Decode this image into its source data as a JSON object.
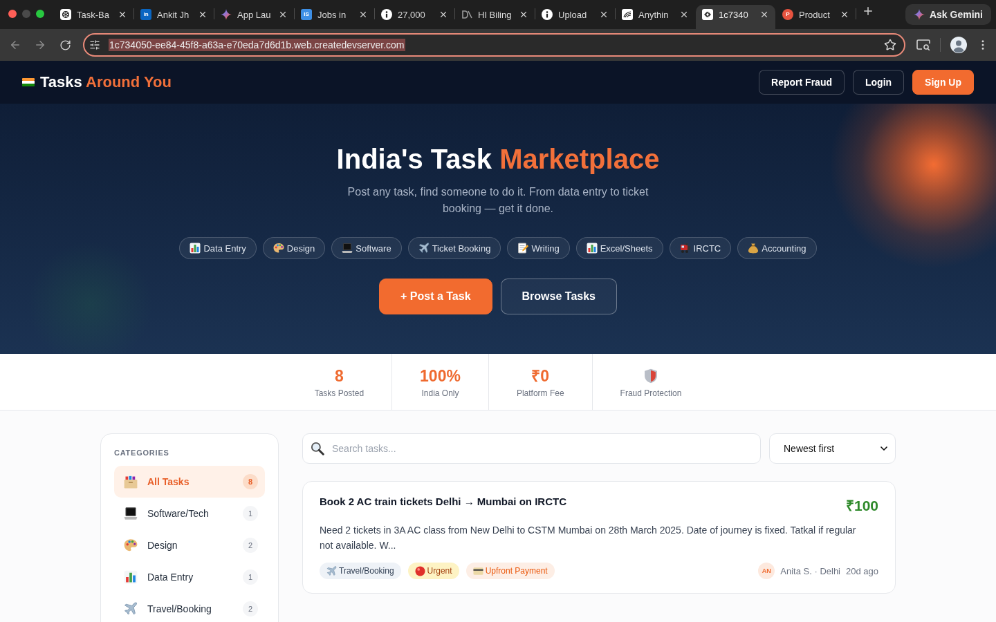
{
  "browser": {
    "tabs": [
      {
        "title": "Task-Ba",
        "kind": "knot",
        "selected": false
      },
      {
        "title": "Ankit Jh",
        "kind": "badge",
        "favicon_text": "in",
        "color": "#0a66c2",
        "selected": false
      },
      {
        "title": "App Lau",
        "kind": "star",
        "selected": false
      },
      {
        "title": "Jobs in",
        "kind": "badge",
        "favicon_text": "IS",
        "color": "#3d8fe6",
        "selected": false
      },
      {
        "title": "27,000",
        "kind": "info",
        "selected": false
      },
      {
        "title": "HI Biling",
        "kind": "mark",
        "selected": false
      },
      {
        "title": "Upload",
        "kind": "info",
        "selected": false
      },
      {
        "title": "Anythin",
        "kind": "swoosh",
        "selected": false
      },
      {
        "title": "1c7340",
        "kind": "link",
        "selected": true
      },
      {
        "title": "Product",
        "kind": "disc",
        "favicon_text": "P",
        "color": "#e8533f",
        "selected": false
      }
    ],
    "gemini_button": "Ask Gemini",
    "address_bar": {
      "url": "1c734050-ee84-45f8-a63a-e70eda7d6d1b.web.createdevserver.com",
      "selected": true
    }
  },
  "header": {
    "logo": {
      "text": "Tasks",
      "highlight": "Around You"
    },
    "buttons": [
      {
        "label": "Report Fraud",
        "kind": "outline"
      },
      {
        "label": "Login",
        "kind": "outline"
      },
      {
        "label": "Sign Up",
        "kind": "primary"
      }
    ]
  },
  "hero": {
    "title": "India's Task",
    "title_highlight": "Marketplace",
    "subtitle": "Post any task, find someone to do it. From data entry to ticket booking — get it done.",
    "chips": [
      {
        "label": "Data Entry",
        "kind": "chart"
      },
      {
        "label": "Design",
        "kind": "palette"
      },
      {
        "label": "Software",
        "kind": "laptop"
      },
      {
        "label": "Ticket Booking",
        "kind": "plane"
      },
      {
        "label": "Writing",
        "kind": "memo"
      },
      {
        "label": "Excel/Sheets",
        "kind": "chart"
      },
      {
        "label": "IRCTC",
        "kind": "train"
      },
      {
        "label": "Accounting",
        "kind": "moneybag"
      }
    ],
    "buttons": [
      {
        "label": "+ Post a Task",
        "kind": "primary"
      },
      {
        "label": "Browse Tasks",
        "kind": "outline"
      }
    ]
  },
  "stats": [
    {
      "kind": "text",
      "value": "8",
      "label": "Tasks Posted"
    },
    {
      "kind": "text",
      "value": "100%",
      "label": "India Only"
    },
    {
      "kind": "text",
      "value": "₹0",
      "label": "Platform Fee"
    },
    {
      "kind": "shield",
      "label": "Fraud Protection"
    }
  ],
  "sidebar": {
    "heading": "CATEGORIES",
    "items": [
      {
        "label": "All Tasks",
        "count": "8",
        "kind": "box",
        "selected": true
      },
      {
        "label": "Software/Tech",
        "count": "1",
        "kind": "laptop",
        "selected": false
      },
      {
        "label": "Design",
        "count": "2",
        "kind": "palette",
        "selected": false
      },
      {
        "label": "Data Entry",
        "count": "1",
        "kind": "chart",
        "selected": false
      },
      {
        "label": "Travel/Booking",
        "count": "2",
        "kind": "plane",
        "selected": false
      }
    ]
  },
  "filters": {
    "search": {
      "placeholder": "Search tasks..."
    },
    "sort": {
      "value": "Newest first"
    }
  },
  "tasks": [
    {
      "title": "Book 2 AC train tickets Delhi → Mumbai on IRCTC",
      "price": "₹100",
      "description": "Need 2 tickets in 3A AC class from New Delhi to CSTM Mumbai on 28th March 2025. Date of journey is fixed. Tatkal if regular not available. W...",
      "tags": [
        {
          "kind": "travel",
          "label": "Travel/Booking"
        },
        {
          "kind": "urgent",
          "label": "Urgent"
        },
        {
          "kind": "payment",
          "label": "Upfront Payment"
        }
      ],
      "avatar": "AN",
      "author": "Anita S. · Delhi",
      "time": "20d ago"
    }
  ]
}
